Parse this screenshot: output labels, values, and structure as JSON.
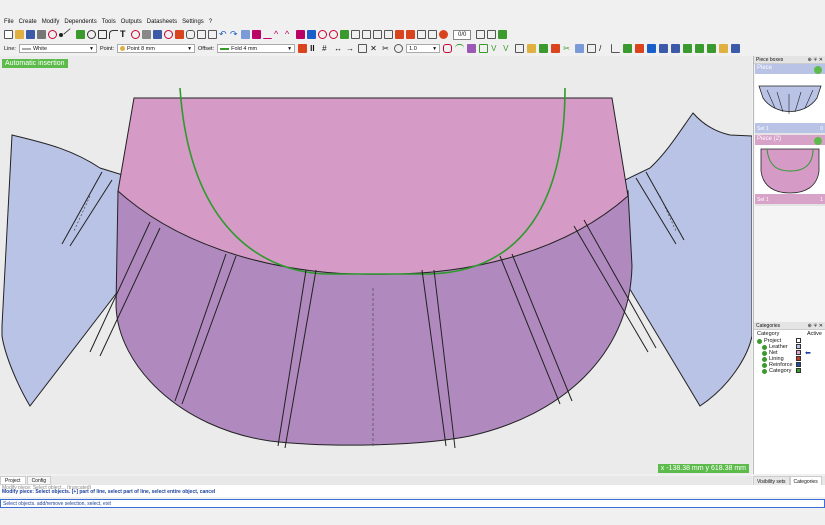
{
  "menu": [
    "File",
    "Create",
    "Modify",
    "Dependents",
    "Tools",
    "Outputs",
    "Datasheets",
    "Settings",
    "?"
  ],
  "toolbar": {
    "page_value": "0/0"
  },
  "options": {
    "line_label": "Line:",
    "line_value": "White",
    "point_label": "Point:",
    "point_value": "Point 8 mm",
    "offset_label": "Offset:",
    "offset_value": "Fold 4 mm",
    "zoom_value": "1.0"
  },
  "canvas": {
    "mode_badge": "Automatic insertion",
    "coords": "x -138.38 mm  y 618.38 mm"
  },
  "piece_boxes": {
    "title": "Piece boxes",
    "pieces": [
      {
        "name": "Piece",
        "set": "Set 1",
        "num": "0"
      },
      {
        "name": "Piece (2)",
        "set": "Set 1",
        "num": "1"
      }
    ]
  },
  "categories": {
    "title": "Categories",
    "col_category": "Category",
    "col_active": "Active",
    "items": [
      "Project",
      "Leather",
      "Net",
      "Lining",
      "Reinforce",
      "Category"
    ],
    "colors": [
      "#ffffff",
      "#b9c3e6",
      "#d8a3c9",
      "#c0392b",
      "#1f4ea3",
      "#3a9a2d"
    ]
  },
  "right_tabs": [
    "Visibility sets",
    "Categories"
  ],
  "bottom_tabs": [
    "Project",
    "Config"
  ],
  "log": {
    "line1": "Modify piece: Select object... (truncated)",
    "line2": "Modify piece: Select objects. [+] part of line, select part of line, select entire object, cancel"
  },
  "command": "Select objects. add/remove selection, select, exit"
}
